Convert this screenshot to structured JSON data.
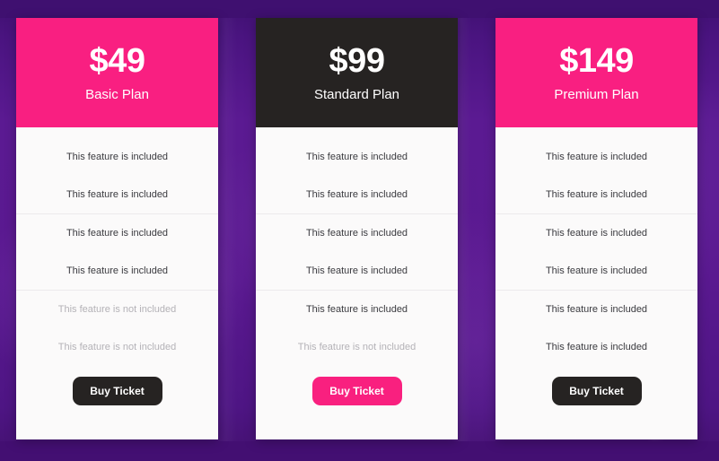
{
  "colors": {
    "background_top": "#3f1070",
    "background_main": "#5b1a92",
    "accent_pink": "#f91f81",
    "accent_dark": "#262322",
    "card_surface": "#fbfafa",
    "feature_text": "#3a3a3f",
    "feature_text_muted": "#b4b2b7"
  },
  "plans": [
    {
      "price": "$49",
      "name": "Basic Plan",
      "header_style": "pink",
      "button_label": "Buy Ticket",
      "button_style": "dark",
      "features": [
        {
          "label": "This feature is included",
          "included": true
        },
        {
          "label": "This feature is included",
          "included": true
        },
        {
          "label": "This feature is included",
          "included": true
        },
        {
          "label": "This feature is included",
          "included": true
        },
        {
          "label": "This feature is not included",
          "included": false
        },
        {
          "label": "This feature is not included",
          "included": false
        }
      ]
    },
    {
      "price": "$99",
      "name": "Standard Plan",
      "header_style": "dark",
      "button_label": "Buy Ticket",
      "button_style": "pink",
      "features": [
        {
          "label": "This feature is included",
          "included": true
        },
        {
          "label": "This feature is included",
          "included": true
        },
        {
          "label": "This feature is included",
          "included": true
        },
        {
          "label": "This feature is included",
          "included": true
        },
        {
          "label": "This feature is included",
          "included": true
        },
        {
          "label": "This feature is not included",
          "included": false
        }
      ]
    },
    {
      "price": "$149",
      "name": "Premium Plan",
      "header_style": "pink",
      "button_label": "Buy Ticket",
      "button_style": "dark",
      "features": [
        {
          "label": "This feature is included",
          "included": true
        },
        {
          "label": "This feature is included",
          "included": true
        },
        {
          "label": "This feature is included",
          "included": true
        },
        {
          "label": "This feature is included",
          "included": true
        },
        {
          "label": "This feature is included",
          "included": true
        },
        {
          "label": "This feature is included",
          "included": true
        }
      ]
    }
  ]
}
